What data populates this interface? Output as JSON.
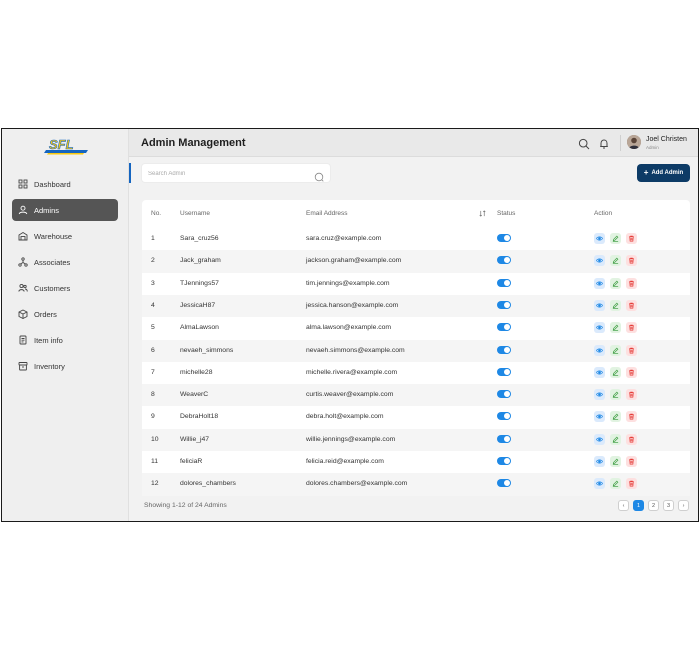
{
  "brand": {
    "logo_text": "SFL"
  },
  "header": {
    "title": "Admin Management",
    "user_name": "Joel Christen",
    "user_role": "Admin"
  },
  "sidebar": {
    "items": [
      {
        "label": "Dashboard",
        "icon": "grid-icon",
        "active": false
      },
      {
        "label": "Admins",
        "icon": "user-icon",
        "active": true
      },
      {
        "label": "Warehouse",
        "icon": "warehouse-icon",
        "active": false
      },
      {
        "label": "Associates",
        "icon": "network-icon",
        "active": false
      },
      {
        "label": "Customers",
        "icon": "users-icon",
        "active": false
      },
      {
        "label": "Orders",
        "icon": "box-icon",
        "active": false
      },
      {
        "label": "Item info",
        "icon": "document-icon",
        "active": false
      },
      {
        "label": "Inventory",
        "icon": "archive-icon",
        "active": false
      }
    ]
  },
  "toolbar": {
    "search_placeholder": "Search Admin",
    "add_label": "Add Admin"
  },
  "table": {
    "columns": {
      "no": "No.",
      "username": "Username",
      "email": "Email Address",
      "status": "Status",
      "action": "Action"
    },
    "rows": [
      {
        "no": "1",
        "username": "Sara_cruz56",
        "email": "sara.cruz@example.com",
        "status": true
      },
      {
        "no": "2",
        "username": "Jack_graham",
        "email": "jackson.graham@example.com",
        "status": true
      },
      {
        "no": "3",
        "username": "TJennings57",
        "email": "tim.jennings@example.com",
        "status": true
      },
      {
        "no": "4",
        "username": "JessicaH87",
        "email": "jessica.hanson@example.com",
        "status": true
      },
      {
        "no": "5",
        "username": "AlmaLawson",
        "email": "alma.lawson@example.com",
        "status": true
      },
      {
        "no": "6",
        "username": "nevaeh_simmons",
        "email": "nevaeh.simmons@example.com",
        "status": true
      },
      {
        "no": "7",
        "username": "michelle28",
        "email": "michelle.rivera@example.com",
        "status": true
      },
      {
        "no": "8",
        "username": "WeaverC",
        "email": "curtis.weaver@example.com",
        "status": true
      },
      {
        "no": "9",
        "username": "DebraHolt18",
        "email": "debra.holt@example.com",
        "status": true
      },
      {
        "no": "10",
        "username": "Willie_j47",
        "email": "willie.jennings@example.com",
        "status": true
      },
      {
        "no": "11",
        "username": "feliciaR",
        "email": "felicia.reid@example.com",
        "status": true
      },
      {
        "no": "12",
        "username": "dolores_chambers",
        "email": "dolores.chambers@example.com",
        "status": true
      }
    ]
  },
  "footer": {
    "showing": "Showing 1-12 of 24 Admins",
    "pages": [
      "1",
      "2",
      "3"
    ],
    "current_page": "1",
    "prev": "‹",
    "next": "›"
  },
  "colors": {
    "accent": "#1e88e5",
    "primary_button": "#0d3b66",
    "active_nav": "#555555",
    "delete": "#e53935",
    "edit": "#43a047"
  }
}
